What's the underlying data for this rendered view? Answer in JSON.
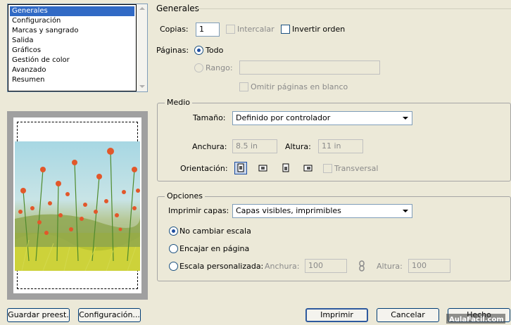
{
  "categories": {
    "items": [
      "Generales",
      "Configuración",
      "Marcas y sangrado",
      "Salida",
      "Gráficos",
      "Gestión de color",
      "Avanzado",
      "Resumen"
    ],
    "selected_index": 0
  },
  "section_title": "Generales",
  "copies": {
    "label": "Copias:",
    "value": "1",
    "collate_label": "Intercalar",
    "reverse_label": "Invertir orden"
  },
  "pages": {
    "label": "Páginas:",
    "all_label": "Todo",
    "range_label": "Rango:",
    "range_value": "",
    "skip_blank_label": "Omitir páginas en blanco"
  },
  "medio": {
    "legend": "Medio",
    "size_label": "Tamaño:",
    "size_value": "Definido por controlador",
    "width_label": "Anchura:",
    "width_value": "8.5 in",
    "height_label": "Altura:",
    "height_value": "11 in",
    "orientation_label": "Orientación:",
    "orientation_icons": [
      "portrait-icon",
      "landscape-icon",
      "reverse-portrait-icon",
      "reverse-landscape-icon"
    ],
    "transverse_label": "Transversal"
  },
  "opciones": {
    "legend": "Opciones",
    "layers_label": "Imprimir capas:",
    "layers_value": "Capas visibles, imprimibles",
    "no_scale_label": "No cambiar escala",
    "fit_label": "Encajar en página",
    "custom_label": "Escala personalizada:",
    "custom_width_label": "Anchura:",
    "custom_width_value": "100",
    "custom_height_label": "Altura:",
    "custom_height_value": "100"
  },
  "buttons": {
    "save_preset": "Guardar preest.",
    "setup": "Configuración...",
    "print": "Imprimir",
    "cancel": "Cancelar",
    "done": "Hecho"
  },
  "watermark": "AulaFacil.com",
  "colors": {
    "selection": "#316ac5",
    "dialog_bg": "#ece9d8",
    "radio_selected": "#21a121"
  }
}
